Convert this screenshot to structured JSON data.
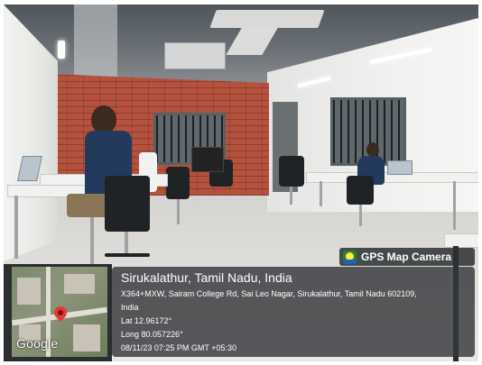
{
  "watermark": {
    "brand": "GPS Map Camera",
    "icon": "gps-map-camera-app-icon"
  },
  "location": {
    "title": "Sirukalathur, Tamil Nadu, India",
    "address_line1": "X364+MXW, Sairam College Rd, Sai Leo Nagar, Sirukalathur, Tamil Nadu 602109,",
    "address_line2": "India",
    "latitude": "Lat 12.96172°",
    "longitude": "Long 80.057226°",
    "datetime": "08/11/23 07:25 PM GMT +05:30"
  },
  "map": {
    "provider_label": "Google",
    "pin_icon": "map-pin-icon",
    "pin_color": "#e53935"
  },
  "scene": {
    "description_tags": [
      "office-interior",
      "brick-wall",
      "desks",
      "office-chairs",
      "people-working"
    ]
  }
}
